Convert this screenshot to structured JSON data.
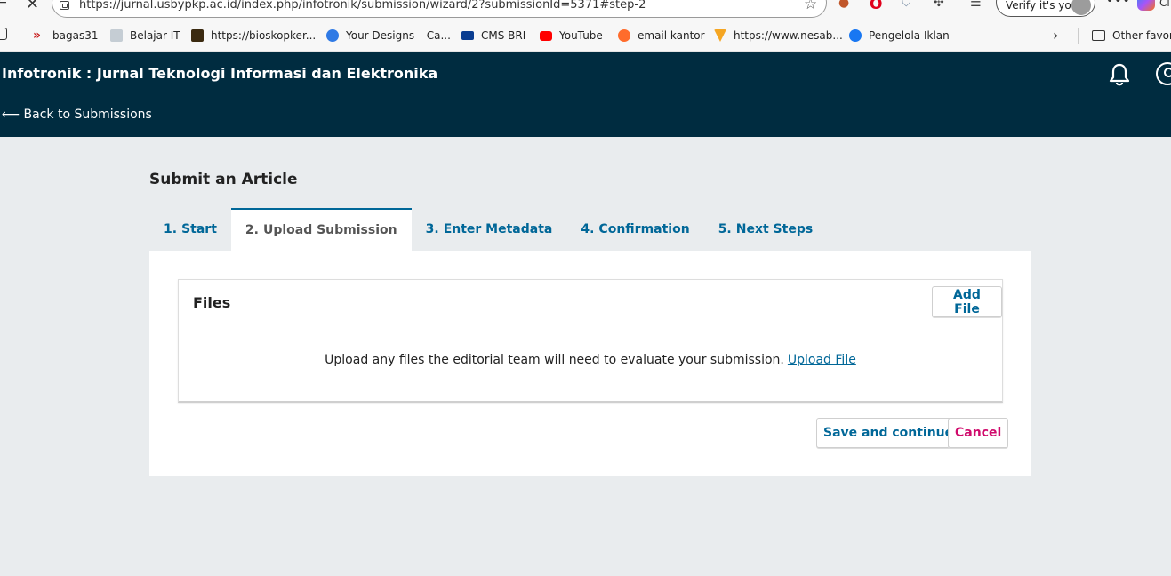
{
  "browser": {
    "url": "https://jurnal.usbypkp.ac.id/index.php/infotronik/submission/wizard/2?submissionId=5371#step-2",
    "verify_label": "Verify it's you",
    "cl_label": "Cl",
    "bookmarks": [
      {
        "label": "bagas31",
        "icon": "bagas31-icon",
        "color": "#c81e1e"
      },
      {
        "label": "Belajar IT",
        "icon": "belajar-it-icon",
        "color": "#9aa7b3"
      },
      {
        "label": "https://bioskopker...",
        "icon": "bioskop-icon",
        "color": "#3b2a10"
      },
      {
        "label": "Your Designs – Ca...",
        "icon": "canva-icon",
        "color": "#2f7ae5"
      },
      {
        "label": "CMS BRI",
        "icon": "cms-bri-icon",
        "color": "#0a3d91"
      },
      {
        "label": "YouTube",
        "icon": "youtube-icon",
        "color": "#ff0000"
      },
      {
        "label": "email kantor",
        "icon": "cpanel-icon",
        "color": "#ff6c2c"
      },
      {
        "label": "https://www.nesab...",
        "icon": "nesab-icon",
        "color": "#f5a623"
      },
      {
        "label": "Pengelola Iklan",
        "icon": "facebook-icon",
        "color": "#1877f2"
      }
    ],
    "other_favorites": "Other favorit"
  },
  "header": {
    "title": "Infotronik : Jurnal Teknologi Informasi dan Elektronika",
    "back_link": "⟵ Back to Submissions"
  },
  "main": {
    "page_title": "Submit an Article",
    "tabs": [
      {
        "num": "1.",
        "label": "Start"
      },
      {
        "num": "2.",
        "label": "Upload Submission"
      },
      {
        "num": "3.",
        "label": "Enter Metadata"
      },
      {
        "num": "4.",
        "label": "Confirmation"
      },
      {
        "num": "5.",
        "label": "Next Steps"
      }
    ],
    "files": {
      "title": "Files",
      "add_button": "Add File",
      "empty_text": "Upload any files the editorial team will need to evaluate your submission.",
      "upload_link": "Upload File"
    },
    "save_button": "Save and continue",
    "cancel_button": "Cancel"
  },
  "colors": {
    "header_bg": "#002c40",
    "primary": "#006798",
    "cancel": "#d00a6c",
    "page_bg": "#e9ecee"
  }
}
